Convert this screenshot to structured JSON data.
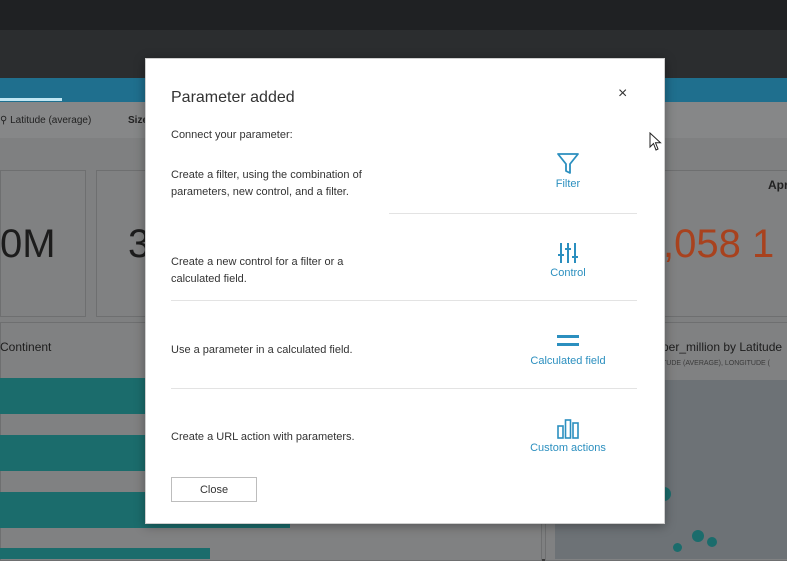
{
  "background": {
    "field_latitude": "Latitude (average)",
    "field_size": "Size",
    "kpi_1": "0M",
    "kpi_2": "3",
    "kpi_3": ",058 1",
    "kpi_3_label": "Apr",
    "bar_chart_label": "Continent",
    "map_title": "per_million by Latitude",
    "map_subtitle": "TUDE (AVERAGE), LONGITUDE ("
  },
  "modal": {
    "title": "Parameter added",
    "close_icon": "×",
    "connect_label": "Connect your parameter:",
    "options": [
      {
        "description": "Create a filter, using the combination of parameters, new control, and a filter.",
        "action_label": "Filter",
        "icon": "filter-icon"
      },
      {
        "description": "Create a new control for a filter or a calculated field.",
        "action_label": "Control",
        "icon": "sliders-icon"
      },
      {
        "description": "Use a parameter in a calculated field.",
        "action_label": "Calculated field",
        "icon": "equals-icon"
      },
      {
        "description": "Create a URL action with parameters.",
        "action_label": "Custom actions",
        "icon": "bar-chart-icon"
      }
    ],
    "close_button": "Close"
  },
  "colors": {
    "accent": "#2b8fbf",
    "kpi_red": "#a8421e",
    "teal": "#1b6c6c"
  }
}
